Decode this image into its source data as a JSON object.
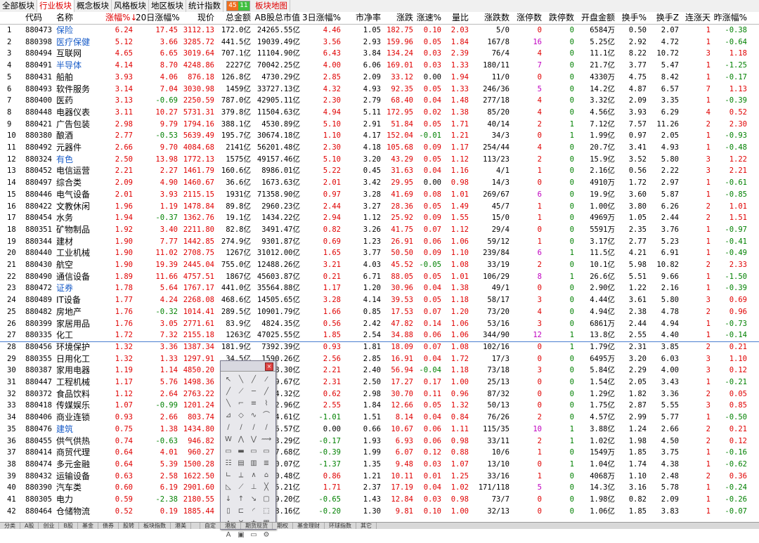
{
  "tabs": [
    {
      "label": "全部板块",
      "style": ""
    },
    {
      "label": "行业板块",
      "style": "active"
    },
    {
      "label": "概念板块",
      "style": ""
    },
    {
      "label": "风格板块",
      "style": ""
    },
    {
      "label": "地区板块",
      "style": ""
    },
    {
      "label": "统计指数",
      "style": ""
    }
  ],
  "counter": {
    "up": "45",
    "down": "11"
  },
  "map_tab": "板块地图",
  "columns": [
    "",
    "代码",
    "名称",
    "涨幅%↓",
    "20日涨幅%",
    "现价",
    "总金额",
    "AB股总市值",
    "3日涨幅%",
    "市净率",
    "涨跌",
    "涨速%",
    "量比",
    "涨跌数",
    "涨停数",
    "跌停数",
    "开盘金额",
    "换手%",
    "换手Z",
    "连涨天",
    "昨涨幅%"
  ],
  "rows": [
    [
      "1",
      "880473",
      "保险",
      "6.24",
      "17.45",
      "3112.13",
      "172.0亿",
      "24265.55亿",
      "4.46",
      "1.05",
      "182.75",
      "0.10",
      "2.03",
      "5/0",
      "0",
      "0",
      "6584万",
      "0.50",
      "2.07",
      "1",
      "-0.38"
    ],
    [
      "2",
      "880398",
      "医疗保健",
      "5.12",
      "3.66",
      "3285.72",
      "441.5亿",
      "19039.49亿",
      "3.56",
      "2.93",
      "159.96",
      "0.05",
      "1.84",
      "167/8",
      "16",
      "0",
      "5.25亿",
      "2.92",
      "4.72",
      "1",
      "-0.64"
    ],
    [
      "3",
      "880494",
      "互联网",
      "4.65",
      "6.65",
      "3019.64",
      "707.1亿",
      "11104.90亿",
      "6.43",
      "3.84",
      "134.24",
      "0.03",
      "2.39",
      "76/4",
      "4",
      "0",
      "11.1亿",
      "8.22",
      "10.72",
      "3",
      "1.18"
    ],
    [
      "4",
      "880491",
      "半导体",
      "4.14",
      "8.70",
      "4248.86",
      "2227亿",
      "70042.25亿",
      "4.00",
      "6.06",
      "169.01",
      "0.03",
      "1.33",
      "180/11",
      "7",
      "0",
      "21.7亿",
      "3.77",
      "5.47",
      "1",
      "-1.25"
    ],
    [
      "5",
      "880431",
      "船舶",
      "3.93",
      "4.06",
      "876.18",
      "126.8亿",
      "4730.29亿",
      "2.85",
      "2.09",
      "33.12",
      "0.00",
      "1.94",
      "11/0",
      "0",
      "0",
      "4330万",
      "4.75",
      "8.42",
      "1",
      "-0.17"
    ],
    [
      "6",
      "880493",
      "软件服务",
      "3.14",
      "7.04",
      "3030.98",
      "1459亿",
      "33727.13亿",
      "4.32",
      "4.93",
      "92.35",
      "0.05",
      "1.33",
      "246/36",
      "5",
      "0",
      "14.2亿",
      "4.87",
      "6.57",
      "7",
      "1.13"
    ],
    [
      "7",
      "880400",
      "医药",
      "3.13",
      "-0.69",
      "2250.59",
      "787.0亿",
      "42905.11亿",
      "2.30",
      "2.79",
      "68.40",
      "0.04",
      "1.48",
      "277/18",
      "4",
      "0",
      "3.32亿",
      "2.09",
      "3.35",
      "1",
      "-0.39"
    ],
    [
      "8",
      "880448",
      "电器仪表",
      "3.11",
      "10.27",
      "5731.31",
      "379.8亿",
      "11504.63亿",
      "4.94",
      "5.11",
      "172.95",
      "0.02",
      "1.38",
      "85/20",
      "4",
      "0",
      "4.56亿",
      "3.93",
      "6.29",
      "4",
      "0.52"
    ],
    [
      "9",
      "880421",
      "广告包装",
      "2.98",
      "9.79",
      "1794.16",
      "388.1亿",
      "4530.89亿",
      "5.10",
      "2.91",
      "51.84",
      "0.05",
      "1.71",
      "40/14",
      "2",
      "1",
      "7.12亿",
      "7.57",
      "11.26",
      "2",
      "2.30"
    ],
    [
      "10",
      "880380",
      "酿酒",
      "2.77",
      "-0.53",
      "5639.49",
      "195.7亿",
      "30674.18亿",
      "1.10",
      "4.17",
      "152.04",
      "-0.01",
      "1.21",
      "34/3",
      "0",
      "1",
      "1.99亿",
      "0.97",
      "2.05",
      "1",
      "-0.93"
    ],
    [
      "11",
      "880492",
      "元器件",
      "2.66",
      "9.70",
      "4084.68",
      "2141亿",
      "56201.48亿",
      "2.30",
      "4.18",
      "105.68",
      "0.09",
      "1.17",
      "254/44",
      "4",
      "0",
      "20.7亿",
      "3.41",
      "4.93",
      "1",
      "-0.48"
    ],
    [
      "12",
      "880324",
      "有色",
      "2.50",
      "13.98",
      "1772.13",
      "1575亿",
      "49157.46亿",
      "5.10",
      "3.20",
      "43.29",
      "0.05",
      "1.12",
      "113/23",
      "2",
      "0",
      "15.9亿",
      "3.52",
      "5.80",
      "3",
      "1.22"
    ],
    [
      "13",
      "880452",
      "电信运营",
      "2.21",
      "2.27",
      "1461.79",
      "160.6亿",
      "8986.01亿",
      "5.22",
      "0.45",
      "31.63",
      "0.04",
      "1.16",
      "4/1",
      "1",
      "0",
      "2.16亿",
      "0.56",
      "2.22",
      "3",
      "2.21"
    ],
    [
      "14",
      "880497",
      "综合类",
      "2.09",
      "4.90",
      "1460.67",
      "36.6亿",
      "1673.63亿",
      "2.01",
      "3.42",
      "29.95",
      "0.00",
      "0.98",
      "14/3",
      "0",
      "0",
      "4910万",
      "1.72",
      "2.97",
      "1",
      "-0.61"
    ],
    [
      "15",
      "880446",
      "电气设备",
      "2.01",
      "3.93",
      "2115.15",
      "1931亿",
      "71358.90亿",
      "0.97",
      "3.28",
      "41.69",
      "0.08",
      "1.01",
      "269/67",
      "6",
      "0",
      "19.9亿",
      "3.60",
      "5.87",
      "1",
      "-0.85"
    ],
    [
      "16",
      "880422",
      "文教休闲",
      "1.96",
      "1.19",
      "1478.84",
      "89.8亿",
      "2960.23亿",
      "2.44",
      "3.27",
      "28.36",
      "0.05",
      "1.49",
      "45/7",
      "1",
      "0",
      "1.00亿",
      "3.80",
      "6.26",
      "2",
      "1.01"
    ],
    [
      "17",
      "880454",
      "水务",
      "1.94",
      "-0.37",
      "1362.76",
      "19.1亿",
      "1434.22亿",
      "2.94",
      "1.12",
      "25.92",
      "0.09",
      "1.55",
      "15/0",
      "1",
      "0",
      "4969万",
      "1.05",
      "2.44",
      "2",
      "1.51"
    ],
    [
      "18",
      "880351",
      "矿物制品",
      "1.92",
      "3.40",
      "2211.80",
      "82.8亿",
      "3491.47亿",
      "0.82",
      "3.26",
      "41.75",
      "0.07",
      "1.12",
      "29/4",
      "0",
      "0",
      "5591万",
      "2.35",
      "3.76",
      "1",
      "-0.97"
    ],
    [
      "19",
      "880344",
      "建材",
      "1.90",
      "7.77",
      "1442.85",
      "274.9亿",
      "9301.87亿",
      "0.69",
      "1.23",
      "26.91",
      "0.06",
      "1.06",
      "59/12",
      "1",
      "0",
      "3.17亿",
      "2.77",
      "5.23",
      "1",
      "-0.41"
    ],
    [
      "20",
      "880440",
      "工业机械",
      "1.90",
      "11.02",
      "2708.75",
      "1267亿",
      "31012.00亿",
      "1.65",
      "3.77",
      "50.50",
      "0.09",
      "1.10",
      "239/84",
      "6",
      "1",
      "11.5亿",
      "4.21",
      "6.91",
      "1",
      "-0.49"
    ],
    [
      "21",
      "880430",
      "航空",
      "1.90",
      "19.39",
      "2445.04",
      "755.0亿",
      "12488.26亿",
      "3.21",
      "4.03",
      "45.52",
      "-0.05",
      "1.08",
      "33/19",
      "2",
      "0",
      "10.1亿",
      "5.98",
      "10.82",
      "2",
      "2.33"
    ],
    [
      "22",
      "880490",
      "通信设备",
      "1.89",
      "11.66",
      "4757.51",
      "1867亿",
      "45603.87亿",
      "0.21",
      "6.71",
      "88.05",
      "0.05",
      "1.01",
      "106/29",
      "8",
      "1",
      "26.6亿",
      "5.51",
      "9.66",
      "1",
      "-1.50"
    ],
    [
      "23",
      "880472",
      "证券",
      "1.78",
      "5.64",
      "1767.17",
      "441.0亿",
      "35564.88亿",
      "1.17",
      "1.20",
      "30.96",
      "0.04",
      "1.38",
      "49/1",
      "0",
      "0",
      "2.90亿",
      "1.22",
      "2.16",
      "1",
      "-0.39"
    ],
    [
      "24",
      "880489",
      "IT设备",
      "1.77",
      "4.24",
      "2268.08",
      "468.6亿",
      "14505.65亿",
      "3.28",
      "4.14",
      "39.53",
      "0.05",
      "1.18",
      "58/17",
      "3",
      "0",
      "4.44亿",
      "3.61",
      "5.80",
      "3",
      "0.69"
    ],
    [
      "25",
      "880482",
      "房地产",
      "1.76",
      "-0.32",
      "1014.41",
      "289.5亿",
      "10901.79亿",
      "1.66",
      "0.85",
      "17.53",
      "0.07",
      "1.20",
      "73/20",
      "4",
      "0",
      "4.94亿",
      "2.38",
      "4.78",
      "2",
      "0.96"
    ],
    [
      "26",
      "880399",
      "家居用品",
      "1.76",
      "3.05",
      "2771.61",
      "83.9亿",
      "4824.35亿",
      "0.56",
      "2.42",
      "47.82",
      "0.14",
      "1.06",
      "53/16",
      "3",
      "0",
      "6861万",
      "2.44",
      "4.94",
      "1",
      "-0.73"
    ],
    [
      "27",
      "880335",
      "化工",
      "1.72",
      "7.32",
      "2155.18",
      "1263亿",
      "47025.55亿",
      "1.85",
      "2.54",
      "34.88",
      "0.06",
      "1.06",
      "344/90",
      "12",
      "1",
      "13.8亿",
      "2.55",
      "4.40",
      "1",
      "-0.14"
    ],
    [
      "28",
      "880456",
      "环境保护",
      "1.32",
      "3.36",
      "1387.34",
      "181.9亿",
      "7392.39亿",
      "0.93",
      "1.81",
      "18.09",
      "0.07",
      "1.08",
      "102/16",
      "0",
      "1",
      "1.79亿",
      "2.31",
      "3.85",
      "2",
      "0.21"
    ],
    [
      "29",
      "880355",
      "日用化工",
      "1.32",
      "1.33",
      "1297.91",
      "34.5亿",
      "1590.26亿",
      "2.56",
      "2.85",
      "16.91",
      "0.04",
      "1.72",
      "17/3",
      "0",
      "0",
      "6495万",
      "3.20",
      "6.03",
      "3",
      "1.10"
    ],
    [
      "30",
      "880387",
      "家用电器",
      "1.19",
      "1.14",
      "4850.20",
      "",
      "18.30亿",
      "2.21",
      "2.40",
      "56.94",
      "-0.04",
      "1.18",
      "73/18",
      "3",
      "0",
      "5.84亿",
      "2.29",
      "4.00",
      "3",
      "0.12"
    ],
    [
      "31",
      "880447",
      "工程机械",
      "1.17",
      "5.76",
      "1498.36",
      "",
      "19.67亿",
      "2.31",
      "2.50",
      "17.27",
      "0.17",
      "1.00",
      "25/13",
      "0",
      "0",
      "1.54亿",
      "2.05",
      "3.43",
      "1",
      "-0.21"
    ],
    [
      "32",
      "880372",
      "食品饮料",
      "1.12",
      "2.64",
      "2763.22",
      "",
      "14.32亿",
      "0.62",
      "2.98",
      "30.70",
      "0.11",
      "0.96",
      "87/32",
      "0",
      "0",
      "1.29亿",
      "1.82",
      "3.36",
      "2",
      "0.05"
    ],
    [
      "33",
      "880418",
      "传媒娱乐",
      "1.07",
      "-0.99",
      "1201.24",
      "",
      "12.96亿",
      "2.55",
      "1.84",
      "12.66",
      "0.05",
      "1.32",
      "50/13",
      "0",
      "0",
      "1.75亿",
      "2.87",
      "5.55",
      "3",
      "0.85"
    ],
    [
      "34",
      "880406",
      "商业连锁",
      "0.93",
      "2.66",
      "803.74",
      "",
      "14.61亿",
      "-1.01",
      "1.51",
      "8.14",
      "0.04",
      "0.84",
      "76/26",
      "2",
      "0",
      "4.57亿",
      "2.99",
      "5.77",
      "1",
      "-0.50"
    ],
    [
      "35",
      "880476",
      "建筑",
      "0.75",
      "1.38",
      "1434.80",
      "",
      "16.57亿",
      "0.00",
      "0.66",
      "10.67",
      "0.06",
      "1.11",
      "115/35",
      "10",
      "1",
      "3.88亿",
      "1.24",
      "2.66",
      "2",
      "0.21"
    ],
    [
      "36",
      "880455",
      "供气供热",
      "0.74",
      "-0.63",
      "946.82",
      "",
      "13.29亿",
      "-0.17",
      "1.93",
      "6.93",
      "0.06",
      "0.98",
      "33/11",
      "2",
      "1",
      "1.02亿",
      "1.98",
      "4.50",
      "2",
      "0.12"
    ],
    [
      "37",
      "880414",
      "商贸代理",
      "0.64",
      "4.01",
      "960.27",
      "",
      "17.68亿",
      "-0.39",
      "1.99",
      "6.07",
      "0.12",
      "0.88",
      "10/6",
      "1",
      "0",
      "1549万",
      "1.85",
      "3.75",
      "1",
      "-0.16"
    ],
    [
      "38",
      "880474",
      "多元金融",
      "0.64",
      "5.39",
      "1500.28",
      "",
      "10.07亿",
      "-1.37",
      "1.35",
      "9.48",
      "0.03",
      "1.07",
      "13/10",
      "0",
      "1",
      "1.04亿",
      "1.74",
      "4.38",
      "1",
      "-0.62"
    ],
    [
      "39",
      "880432",
      "运输设备",
      "0.63",
      "2.58",
      "1622.50",
      "",
      "10.48亿",
      "0.86",
      "1.21",
      "10.11",
      "0.01",
      "1.25",
      "33/16",
      "1",
      "0",
      "4068万",
      "1.10",
      "2.48",
      "2",
      "0.36"
    ],
    [
      "40",
      "880390",
      "汽车类",
      "0.60",
      "6.19",
      "2901.60",
      "",
      "15.21亿",
      "1.71",
      "2.37",
      "17.19",
      "0.04",
      "1.02",
      "171/118",
      "5",
      "0",
      "14.3亿",
      "3.16",
      "5.78",
      "1",
      "-0.24"
    ],
    [
      "41",
      "880305",
      "电力",
      "0.59",
      "-2.38",
      "2180.55",
      "",
      "19.20亿",
      "-0.65",
      "1.43",
      "12.84",
      "0.03",
      "0.98",
      "73/7",
      "0",
      "0",
      "1.98亿",
      "0.82",
      "2.09",
      "1",
      "-0.26"
    ],
    [
      "42",
      "880464",
      "仓储物流",
      "0.52",
      "0.19",
      "1885.44",
      "",
      "18.16亿",
      "-0.20",
      "1.30",
      "9.81",
      "0.10",
      "1.00",
      "32/13",
      "0",
      "0",
      "1.06亿",
      "1.85",
      "3.83",
      "1",
      "-0.07"
    ]
  ],
  "blue_names": [
    "保险",
    "医疗保健",
    "半导体",
    "有色",
    "证券",
    "建筑"
  ],
  "bottom_tabs": [
    "分类",
    "A股",
    "创业",
    "B股",
    "基金",
    "债券",
    "股转",
    "板块指数",
    "港美",
    "",
    "自定",
    "港股",
    "期货现货",
    "期权",
    "基金理财",
    "环球指数",
    "其它"
  ],
  "colors": {
    "up": "#e00000",
    "down": "#008000",
    "blue": "#1a5dc8",
    "magenta": "#c000c0"
  }
}
